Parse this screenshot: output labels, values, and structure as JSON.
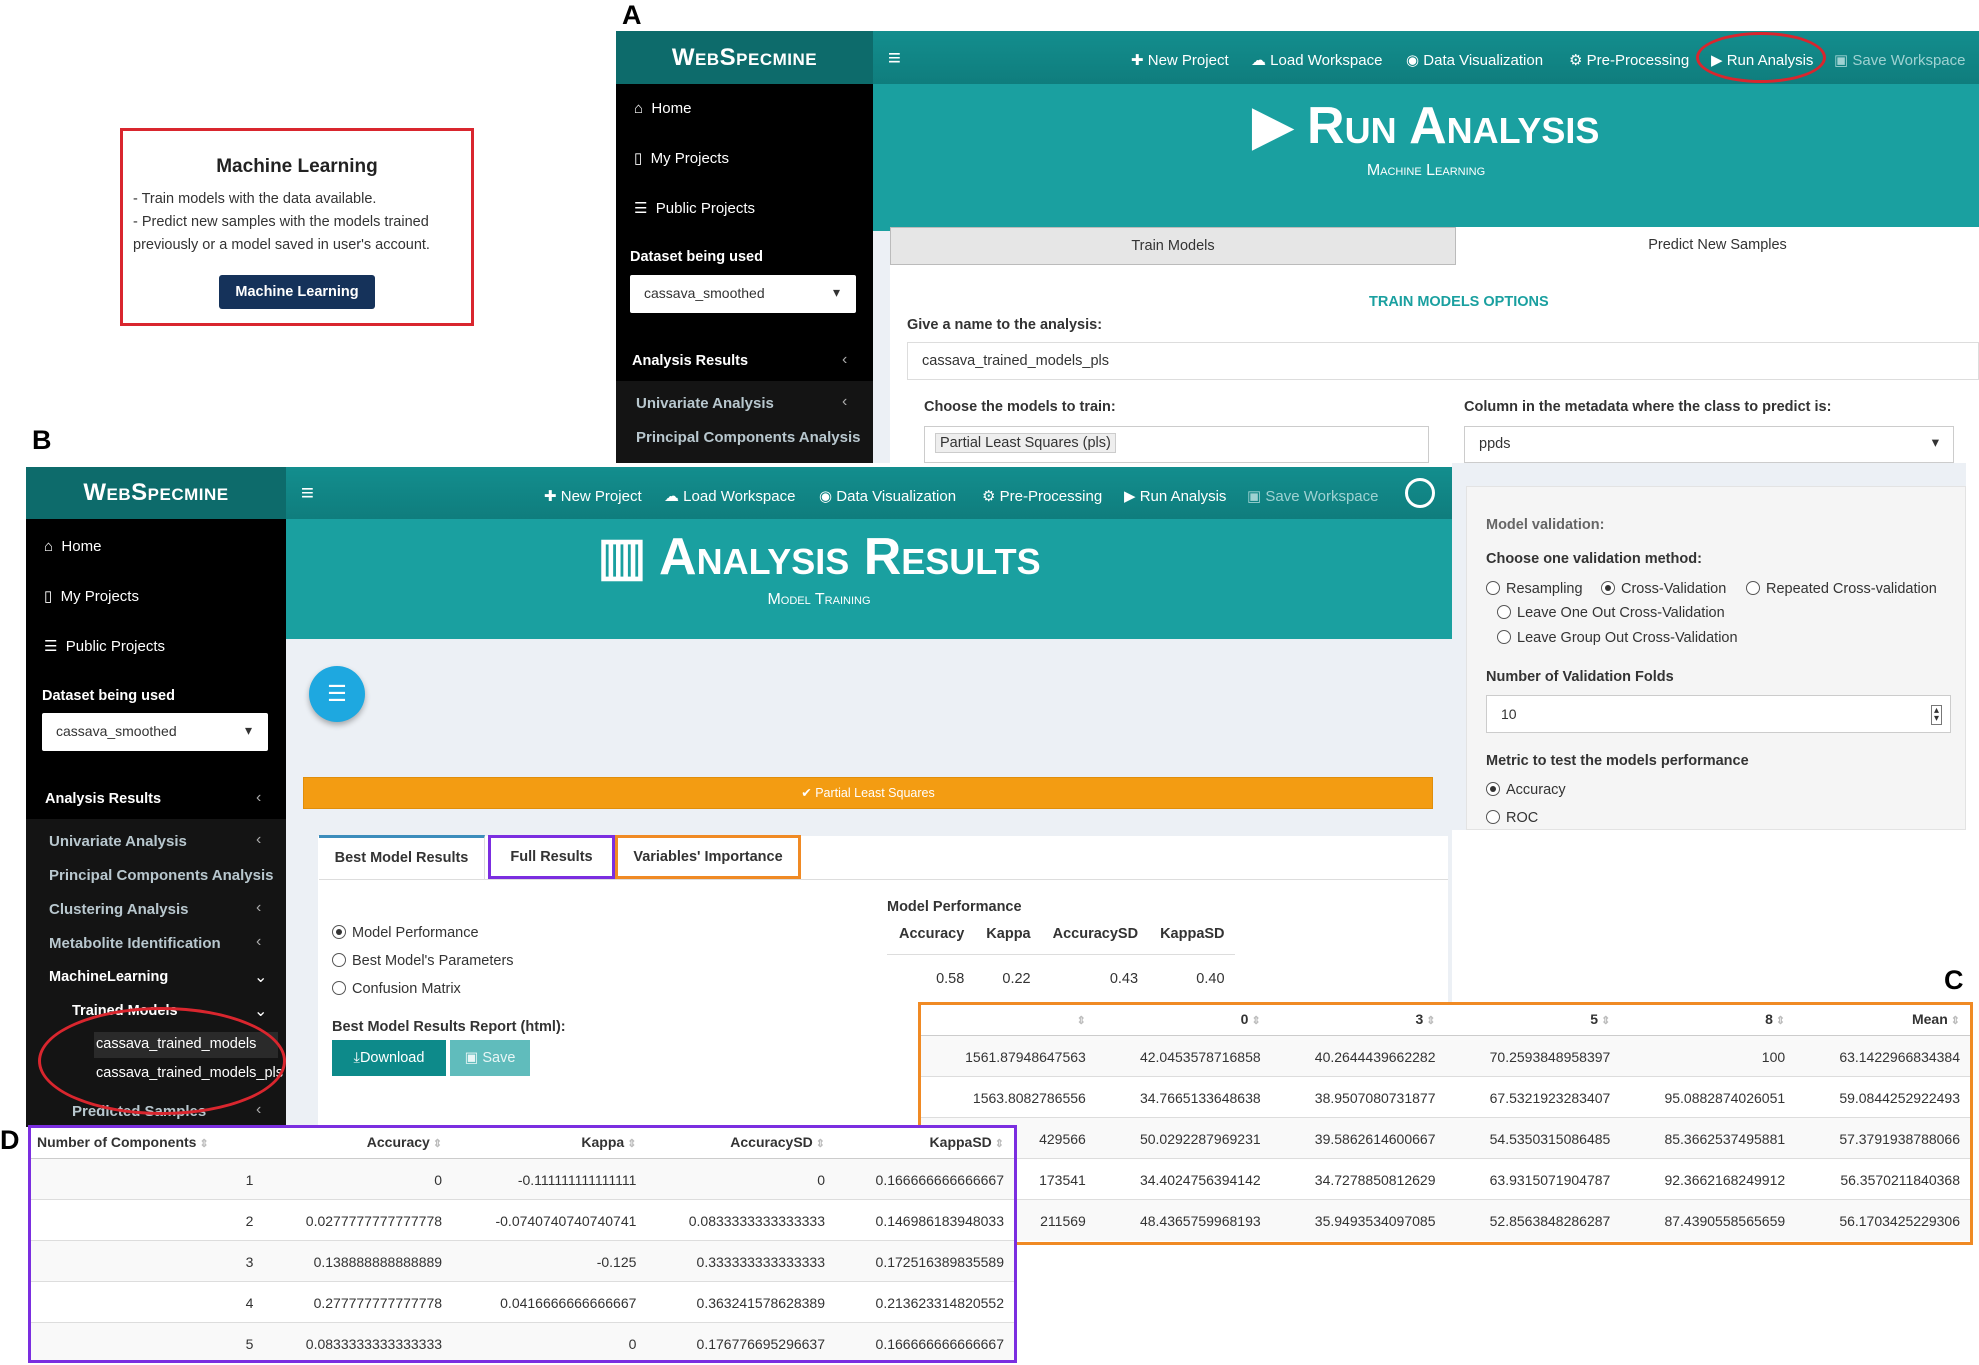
{
  "labels": {
    "a": "A",
    "b": "B",
    "c": "C",
    "d": "D"
  },
  "ml_card": {
    "title": "Machine Learning",
    "line1": "- Train models with the data available.",
    "line2": "- Predict new samples with the models trained previously or a model saved in user's account.",
    "button": "Machine Learning"
  },
  "app_a": {
    "brand": "WebSpecmine",
    "nav": [
      "New Project",
      "Load Workspace",
      "Data Visualization",
      "Pre-Processing",
      "Run Analysis",
      "Save Workspace"
    ],
    "sidebar": {
      "home": "Home",
      "my_projects": "My Projects",
      "public_projects": "Public Projects",
      "dataset_label": "Dataset being used",
      "dataset_value": "cassava_smoothed",
      "analysis_results": "Analysis Results",
      "univariate": "Univariate Analysis",
      "pca": "Principal Components Analysis"
    },
    "title": "Run Analysis",
    "subtitle": "Machine Learning",
    "tabs": [
      "Train Models",
      "Predict New Samples"
    ],
    "section": "TRAIN MODELS OPTIONS",
    "name_label": "Give a name to the analysis:",
    "name_value": "cassava_trained_models_pls",
    "models_label": "Choose the models to train:",
    "models_value": "Partial Least Squares (pls)",
    "column_label": "Column in the metadata where the class to predict is:",
    "column_value": "ppds",
    "validation": {
      "heading": "Model validation:",
      "choose": "Choose one validation method:",
      "options": [
        "Resampling",
        "Cross-Validation",
        "Repeated Cross-validation",
        "Leave One Out Cross-Validation",
        "Leave Group Out Cross-Validation"
      ],
      "folds_label": "Number of Validation Folds",
      "folds_value": "10",
      "metric_label": "Metric to test the models performance",
      "metric_options": [
        "Accuracy",
        "ROC"
      ]
    }
  },
  "app_b": {
    "brand": "WebSpecmine",
    "nav": [
      "New Project",
      "Load Workspace",
      "Data Visualization",
      "Pre-Processing",
      "Run Analysis",
      "Save Workspace"
    ],
    "sidebar": {
      "home": "Home",
      "my_projects": "My Projects",
      "public_projects": "Public Projects",
      "dataset_label": "Dataset being used",
      "dataset_value": "cassava_smoothed",
      "analysis_results": "Analysis Results",
      "univariate": "Univariate Analysis",
      "pca": "Principal Components Analysis",
      "clustering": "Clustering Analysis",
      "metabolite": "Metabolite Identification",
      "ml": "MachineLearning",
      "trained": "Trained Models",
      "model1": "cassava_trained_models",
      "model2": "cassava_trained_models_pls",
      "predicted": "Predicted Samples"
    },
    "title": "Analysis Results",
    "subtitle": "Model Training",
    "collapse_label": "Partial Least Squares",
    "tabs": [
      "Best Model Results",
      "Full Results",
      "Variables' Importance"
    ],
    "radios": [
      "Model Performance",
      "Best Model's Parameters",
      "Confusion Matrix"
    ],
    "report_label": "Best Model Results Report (html):",
    "download": "Download",
    "save": "Save",
    "perf_title": "Model Performance",
    "perf_headers": [
      "Accuracy",
      "Kappa",
      "AccuracySD",
      "KappaSD"
    ],
    "perf_values": [
      "0.58",
      "0.22",
      "0.43",
      "0.40"
    ]
  },
  "table_c": {
    "headers": [
      "",
      "0",
      "3",
      "5",
      "8",
      "Mean"
    ],
    "rows": [
      [
        "1561.87948647563",
        "42.0453578716858",
        "40.2644439662282",
        "70.2593848958397",
        "100",
        "63.1422966834384"
      ],
      [
        "1563.8082786556",
        "34.7665133648638",
        "38.9507080731877",
        "67.5321923283407",
        "95.0882874026051",
        "59.0844252922493"
      ],
      [
        "429566",
        "50.0292287969231",
        "39.5862614600667",
        "54.5350315086485",
        "85.3662537495881",
        "57.3791938788066"
      ],
      [
        "173541",
        "34.4024756394142",
        "34.7278850812629",
        "63.9315071904787",
        "92.3662168249912",
        "56.3570211840368"
      ],
      [
        "211569",
        "48.4365759968193",
        "35.9493534097085",
        "52.8563848286287",
        "87.4390558565659",
        "56.1703425229306"
      ]
    ]
  },
  "table_d": {
    "headers": [
      "Number of Components",
      "Accuracy",
      "Kappa",
      "AccuracySD",
      "KappaSD"
    ],
    "rows": [
      [
        "1",
        "0",
        "-0.111111111111111",
        "0",
        "0.166666666666667"
      ],
      [
        "2",
        "0.0277777777777778",
        "-0.0740740740740741",
        "0.0833333333333333",
        "0.146986183948033"
      ],
      [
        "3",
        "0.138888888888889",
        "-0.125",
        "0.333333333333333",
        "0.172516389835589"
      ],
      [
        "4",
        "0.277777777777778",
        "0.0416666666666667",
        "0.363241578628389",
        "0.213623314820552"
      ],
      [
        "5",
        "0.0833333333333333",
        "0",
        "0.176776695296637",
        "0.166666666666667"
      ]
    ]
  },
  "colors": {
    "teal": "#1aa0a0",
    "header": "#138e8e",
    "highlight_red": "#d9262e",
    "highlight_orange": "#f08a24",
    "highlight_purple": "#7b2ee0",
    "orange_bar": "#f39c12",
    "navy_button": "#15325a"
  }
}
